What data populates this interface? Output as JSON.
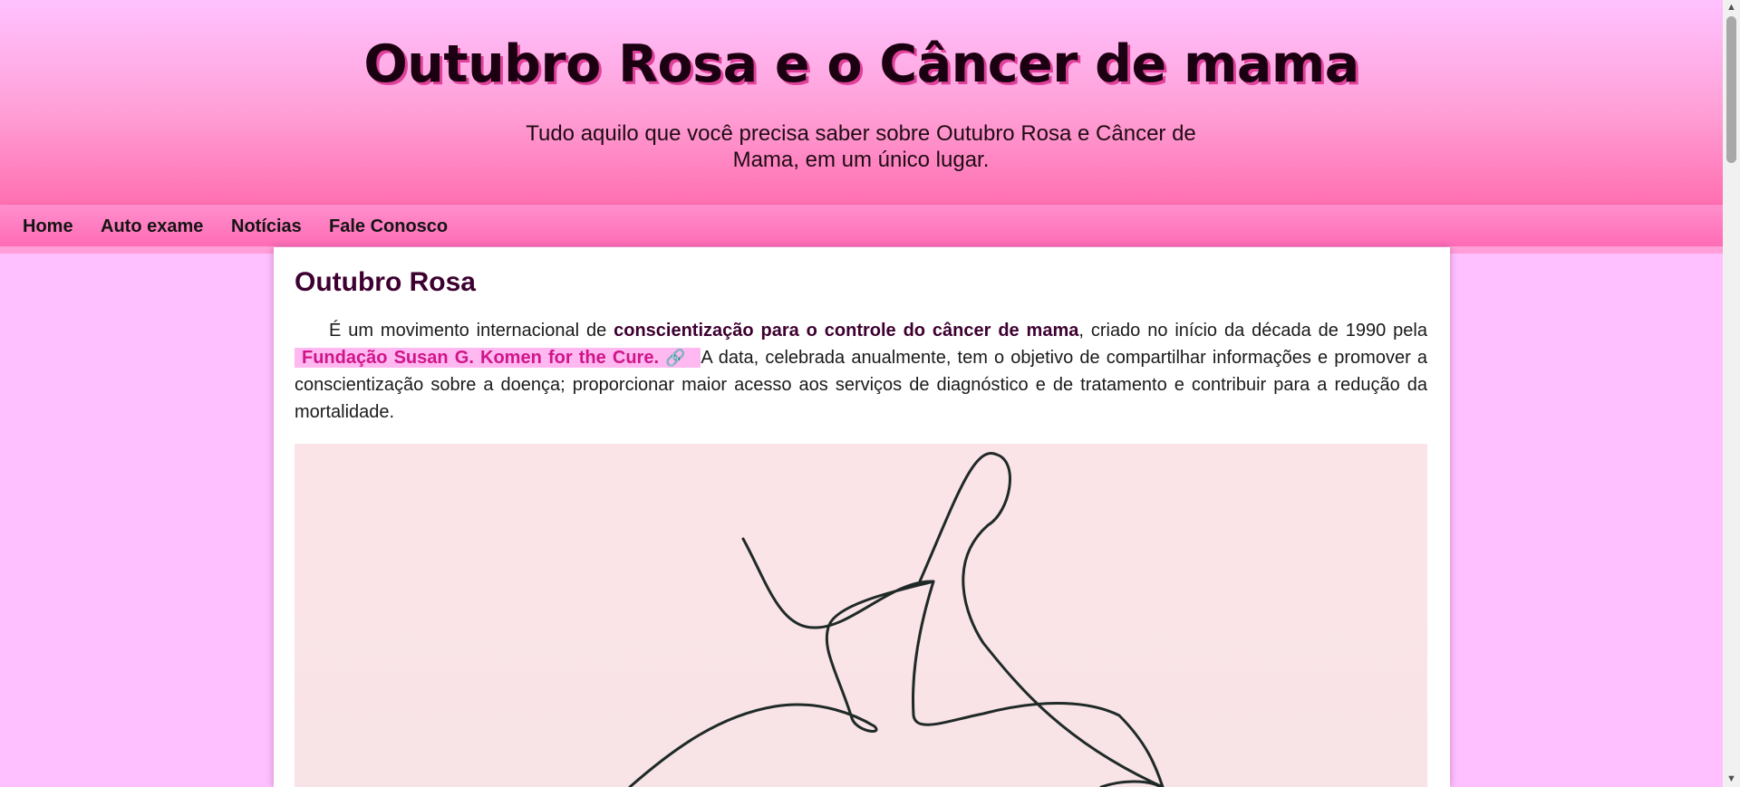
{
  "header": {
    "title": "Outubro Rosa e o Câncer de mama",
    "subtitle_line1": "Tudo aquilo que você precisa saber sobre Outubro Rosa e Câncer de",
    "subtitle_line2": "Mama, em um único lugar."
  },
  "nav": {
    "items": [
      {
        "label": "Home"
      },
      {
        "label": "Auto exame"
      },
      {
        "label": "Notícias"
      },
      {
        "label": "Fale Conosco"
      }
    ]
  },
  "post": {
    "title": "Outubro Rosa",
    "text_intro": "É um movimento internacional de ",
    "text_bold": "conscientização para o controle do câncer de mama",
    "text_mid": ", criado no início da década de 1990 pela ",
    "link_label": "Fundação Susan G. Komen for the Cure.",
    "link_icon": "link-icon",
    "text_rest": " A data, celebrada anualmente, tem o objetivo de compartilhar informações e promover a conscientização sobre a doença; proporcionar maior acesso aos serviços de diagnóstico e de tratamento e contribuir para a redução da mortalidade."
  },
  "colors": {
    "page_bg": "#ffc0ff",
    "header_bottom": "#ff6fb0",
    "title_shadow": "#e0409a",
    "post_title": "#3d0030",
    "link_bg": "#ffb8f0",
    "link_text": "#d0158a"
  },
  "scrollbar": {
    "up_icon": "arrow-up-icon",
    "down_icon": "arrow-down-icon"
  }
}
